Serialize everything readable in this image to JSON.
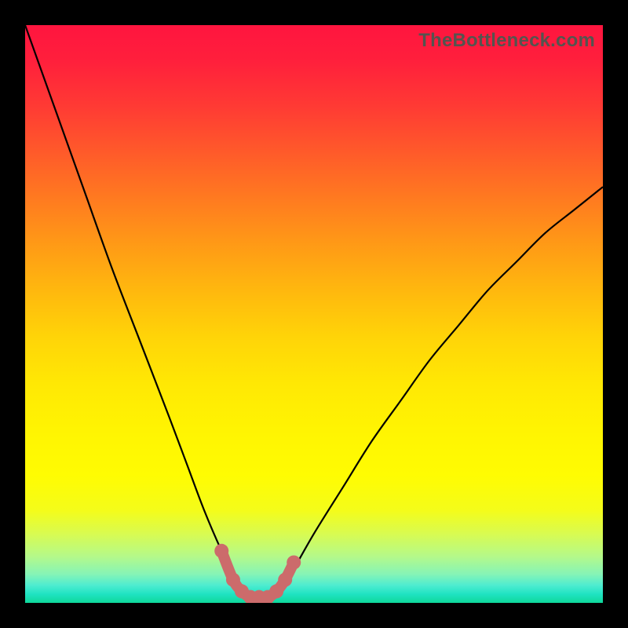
{
  "watermark": "TheBottleneck.com",
  "colors": {
    "frame": "#000000",
    "curve": "#000000",
    "markers_fill": "#cc6b6b",
    "markers_stroke": "#cc6b6b"
  },
  "chart_data": {
    "type": "line",
    "title": "",
    "xlabel": "",
    "ylabel": "",
    "xlim": [
      0,
      100
    ],
    "ylim": [
      0,
      100
    ],
    "grid": false,
    "series": [
      {
        "name": "curve",
        "x": [
          0,
          5,
          10,
          15,
          20,
          25,
          28,
          31,
          34,
          36,
          38,
          40,
          42,
          44,
          46,
          50,
          55,
          60,
          65,
          70,
          75,
          80,
          85,
          90,
          95,
          100
        ],
        "values": [
          100,
          86,
          72,
          58,
          45,
          32,
          24,
          16,
          9,
          5,
          2,
          1,
          1,
          2,
          5,
          12,
          20,
          28,
          35,
          42,
          48,
          54,
          59,
          64,
          68,
          72
        ]
      }
    ],
    "markers": {
      "name": "highlight-points",
      "x": [
        34,
        36,
        37.5,
        39,
        40.5,
        42,
        43.5,
        45,
        46.5
      ],
      "values": [
        9,
        4,
        2,
        1,
        1,
        1,
        2,
        4,
        7
      ]
    }
  }
}
